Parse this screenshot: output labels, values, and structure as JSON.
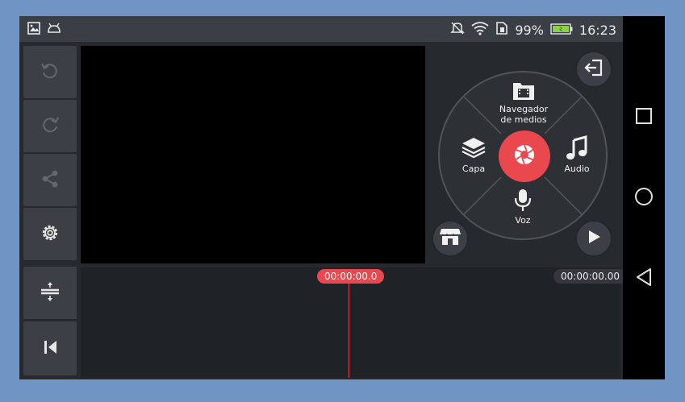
{
  "status_bar": {
    "battery": "99%",
    "time": "16:23"
  },
  "left_tools": [
    {
      "icon": "undo-icon"
    },
    {
      "icon": "redo-icon"
    },
    {
      "icon": "share-icon"
    },
    {
      "icon": "settings-icon"
    },
    {
      "icon": "expand-timeline-icon"
    },
    {
      "icon": "skip-to-start-icon"
    }
  ],
  "wheel": {
    "media_browser_label": "Navegador\nde medios",
    "layer_label": "Capa",
    "audio_label": "Audio",
    "voice_label": "Voz"
  },
  "timeline": {
    "current_time": "00:00:00.0",
    "total_time": "00:00:00.00"
  },
  "colors": {
    "accent": "#e8484e",
    "panel": "#3c4046",
    "background": "#262a2f"
  }
}
